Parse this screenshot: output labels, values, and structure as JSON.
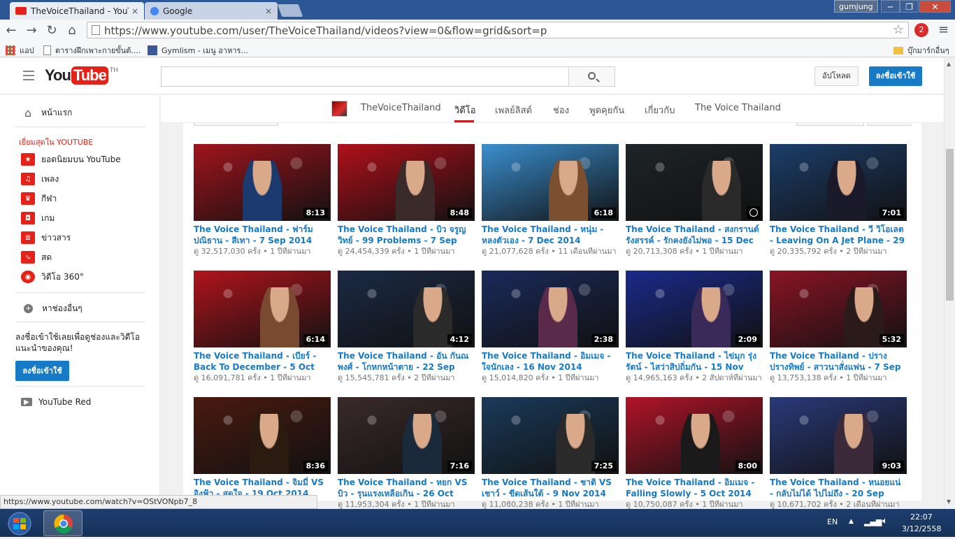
{
  "browser": {
    "tabs": [
      {
        "title": "TheVoiceThailand - YouTu",
        "favicon_color": "#e62117"
      },
      {
        "title": "Google",
        "favicon_color": "#4285f4"
      }
    ],
    "tab_close": "×",
    "user": "gumjung",
    "win_min": "─",
    "win_max": "❐",
    "win_close": "✕",
    "url": "https://www.youtube.com/user/TheVoiceThailand/videos?view=0&flow=grid&sort=p",
    "back": "←",
    "forward": "→",
    "reload": "↻",
    "home": "⌂",
    "star": "☆",
    "menu": "≡",
    "ext_badge": "2",
    "bookmarks": [
      {
        "label": "แอป"
      },
      {
        "label": "ตารางฝึกเพาะกายขั้นต้...."
      },
      {
        "label": "Gymlism - เมนู อาหาร..."
      }
    ],
    "bookmarks_folder": "บุ๊กมาร์กอื่นๆ",
    "status_url": "https://www.youtube.com/watch?v=OStVONpb7_8"
  },
  "masthead": {
    "logo_you": "You",
    "logo_tube": "Tube",
    "logo_region": "TH",
    "upload_label": "อัปโหลด",
    "signin_label": "ลงชื่อเข้าใช้"
  },
  "guide": {
    "home": "หน้าแรก",
    "best_heading": "เยี่ยมสุดใน YOUTUBE",
    "items": [
      {
        "label": "ยอดนิยมบน YouTube",
        "color": "#e62117"
      },
      {
        "label": "เพลง",
        "color": "#e62117"
      },
      {
        "label": "กีฬา",
        "color": "#e62117"
      },
      {
        "label": "เกม",
        "color": "#e62117"
      },
      {
        "label": "ข่าวสาร",
        "color": "#e62117"
      },
      {
        "label": "สด",
        "color": "#e62117"
      },
      {
        "label": "วิดีโอ 360°",
        "color": "#e62117"
      }
    ],
    "browse_channels": "หาช่องอื่นๆ",
    "promo": "ลงชื่อเข้าใช้เลยเพื่อดูช่องและวิดีโอแนะนำของคุณ!",
    "signin_label": "ลงชื่อเข้าใช้",
    "youtube_red": "YouTube Red"
  },
  "channel": {
    "name": "TheVoiceThailand",
    "tabs": [
      "วิดีโอ",
      "เพลย์ลิสต์",
      "ช่อง",
      "พูดคุยกัน",
      "เกี่ยวกับ",
      "The Voice Thailand"
    ],
    "active_tab": "วิดีโอ"
  },
  "videos": [
    {
      "title": "The Voice Thailand - ฟาร์ม ปณิธาน - สีเทา - 7 Sep 2014",
      "meta": "ดู 32,517,030 ครั้ง • 1 ปีที่ผ่านมา",
      "duration": "8:13",
      "bg": "#a0141c",
      "fg": "#1a3a70"
    },
    {
      "title": "The Voice Thailand - บิว จรูญวิทย์ - 99 Problems - 7 Sep 2014",
      "meta": "ดู 24,454,339 ครั้ง • 1 ปีที่ผ่านมา",
      "duration": "8:48",
      "bg": "#b0101a",
      "fg": "#3a2a2a"
    },
    {
      "title": "The Voice Thailand - หนุ่ม - หลงตัวเอง - 7 Dec 2014",
      "meta": "ดู 21,077,628 ครั้ง • 11 เดือนที่ผ่านมา",
      "duration": "6:18",
      "bg": "#3a8fd0",
      "fg": "#7a5030"
    },
    {
      "title": "The Voice Thailand - สงกรานต์ รังสรรค์ - รักคงยังไม่พอ - 15 Dec 2014",
      "meta": "ดู 20,713,308 ครั้ง • 1 ปีที่ผ่านมา",
      "duration": "",
      "bg": "#1e2428",
      "fg": "#2a2a2a"
    },
    {
      "title": "The Voice Thailand - วี วิโอเลต - Leaving On A Jet Plane - 29 Sep 2014",
      "meta": "ดู 20,335,792 ครั้ง • 2 ปีที่ผ่านมา",
      "duration": "7:01",
      "bg": "#1c3e6a",
      "fg": "#1a1a2a"
    },
    {
      "title": "The Voice Thailand - เบียร์ - Back To December - 5 Oct 2014",
      "meta": "ดู 16,091,781 ครั้ง • 1 ปีที่ผ่านมา",
      "duration": "6:14",
      "bg": "#b0141c",
      "fg": "#7a4a30"
    },
    {
      "title": "The Voice Thailand - อัน กันณพงศ์ - โกหกหน้าตาย - 22 Sep 2013",
      "meta": "ดู 15,545,781 ครั้ง • 2 ปีที่ผ่านมา",
      "duration": "4:12",
      "bg": "#1a2a44",
      "fg": "#2a2a2a"
    },
    {
      "title": "The Voice Thailand - อิมเมจ - ใจนักเลง - 16 Nov 2014",
      "meta": "ดู 15,014,820 ครั้ง • 1 ปีที่ผ่านมา",
      "duration": "2:38",
      "bg": "#1a2a5a",
      "fg": "#5a2a4a"
    },
    {
      "title": "The Voice Thailand - ไข่มุก รุ่งรัตน์ - ไสว่าสิบ่ถิ่มกัน - 15 Nov 2015",
      "meta": "ดู 14,965,163 ครั้ง • 2 สัปดาห์ที่ผ่านมา",
      "duration": "2:09",
      "bg": "#1a2a8a",
      "fg": "#3a2a5a"
    },
    {
      "title": "The Voice Thailand - ปราง ปรางทิพย์ - สาวนาสั่งแฟน - 7 Sep 2014",
      "meta": "ดู 13,753,138 ครั้ง • 1 ปีที่ผ่านมา",
      "duration": "5:32",
      "bg": "#8a1424",
      "fg": "#2a1a1a"
    },
    {
      "title": "The Voice Thailand - จิมมี่ VS อิงฟ้า - สุดใจ - 19 Oct 2014",
      "meta": "ดู 12,117,010 ครั้ง • 1 ปีที่ผ่านมา",
      "duration": "8:36",
      "bg": "#4a1a10",
      "fg": "#2a1a10"
    },
    {
      "title": "The Voice Thailand - หยก VS บิว - รุนแรงเหลือเกิน - 26 Oct 2014",
      "meta": "ดู 11,953,304 ครั้ง • 1 ปีที่ผ่านมา",
      "duration": "7:16",
      "bg": "#3a2a2a",
      "fg": "#1a2a3a"
    },
    {
      "title": "The Voice Thailand - ชาติ VS เชาว์ - ขีดเส้นใต้ - 9 Nov 2014",
      "meta": "ดู 11,080,238 ครั้ง • 1 ปีที่ผ่านมา",
      "duration": "7:25",
      "bg": "#1a3a5a",
      "fg": "#2a2a2a"
    },
    {
      "title": "The Voice Thailand - อิมเมจ - Falling Slowly - 5 Oct 2014",
      "meta": "ดู 10,750,087 ครั้ง • 1 ปีที่ผ่านมา",
      "duration": "8:00",
      "bg": "#b01428",
      "fg": "#1a1a1a"
    },
    {
      "title": "The Voice Thailand - หนอยแน่ - กลับไม่ได้ ไปไม่ถึง - 20 Sep 2015",
      "meta": "ดู 10,671,702 ครั้ง • 2 เดือนที่ผ่านมา",
      "duration": "9:03",
      "bg": "#2a3a7a",
      "fg": "#3a2a3a"
    }
  ],
  "taskbar": {
    "language": "EN",
    "time": "22:07",
    "date": "3/12/2558"
  }
}
